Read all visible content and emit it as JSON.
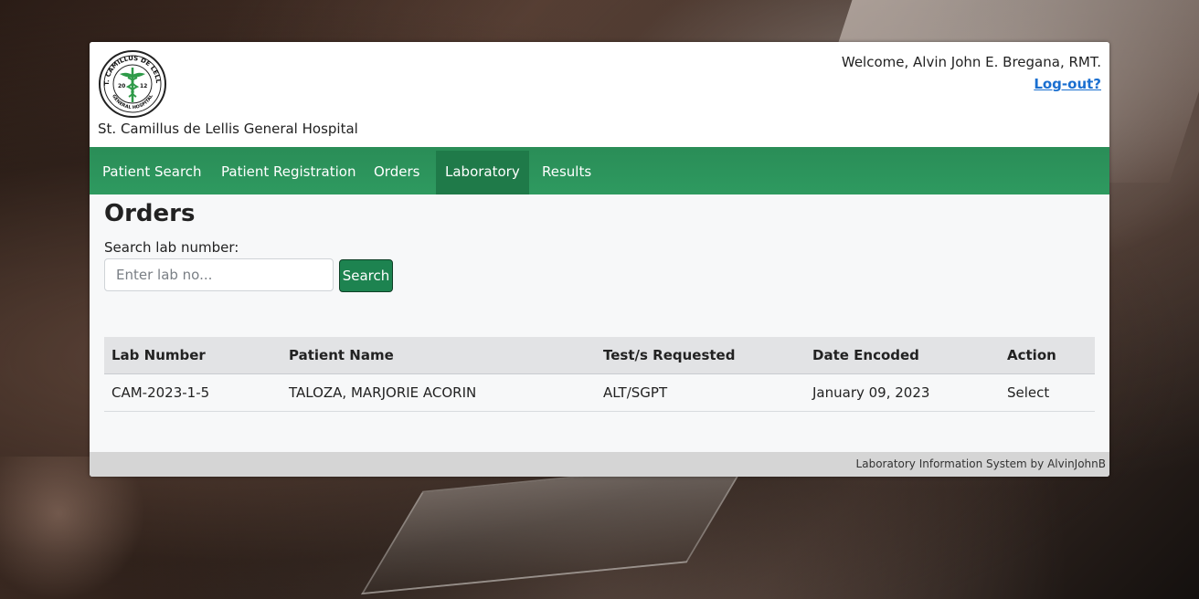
{
  "header": {
    "hospital_name": "St. Camillus de Lellis General Hospital",
    "welcome": "Welcome, Alvin John E. Bregana, RMT.",
    "logout": "Log-out?",
    "logo": {
      "top_text": "ST. CAMILLUS DE LELLIS",
      "bottom_text": "GENERAL HOSPITAL",
      "left_digits": "20",
      "right_digits": "12",
      "color": "#2e9a48"
    }
  },
  "nav": {
    "items": [
      {
        "label": "Patient Search"
      },
      {
        "label": "Patient Registration"
      },
      {
        "label": "Orders"
      },
      {
        "label": "Laboratory",
        "active": true
      },
      {
        "label": "Results"
      }
    ],
    "color": "#2e9a60"
  },
  "main": {
    "title": "Orders",
    "search": {
      "label": "Search lab number:",
      "placeholder": "Enter lab no...",
      "value": "",
      "button": "Search"
    },
    "table": {
      "headers": [
        "Lab Number",
        "Patient Name",
        "Test/s Requested",
        "Date Encoded",
        "Action"
      ],
      "rows": [
        [
          "CAM-2023-1-5",
          "TALOZA, MARJORIE ACORIN",
          "ALT/SGPT",
          "January 09, 2023",
          "Select"
        ]
      ]
    }
  },
  "footer": {
    "text": "Laboratory Information System by AlvinJohnB"
  }
}
